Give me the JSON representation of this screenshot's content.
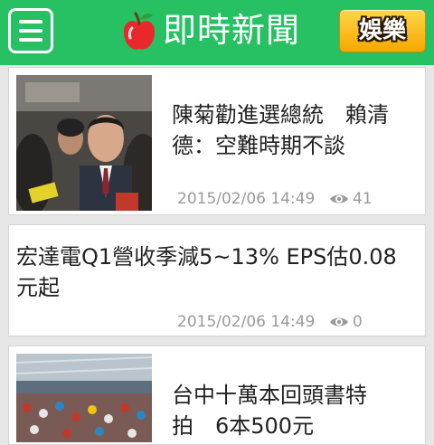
{
  "header": {
    "title": "即時新聞",
    "entertainment_label": "娛樂",
    "menu_icon": "hamburger-menu-icon",
    "logo_icon": "apple-logo-icon",
    "brand_color": "#27c063"
  },
  "articles": [
    {
      "title_line1": "陳菊勸進選總統　賴清",
      "title_line2": "德：空難時期不談",
      "timestamp": "2015/02/06 14:49",
      "views": "41",
      "view_icon": "eye-icon"
    },
    {
      "title_line1": "宏達電Q1營收季減5~13% EPS估0.08",
      "title_line2": "元起",
      "timestamp": "2015/02/06 14:49",
      "views": "0",
      "view_icon": "eye-icon"
    },
    {
      "title_line1": "台中十萬本回頭書特",
      "title_line2": "拍　6本500元",
      "timestamp": "",
      "views": "",
      "view_icon": "eye-icon"
    }
  ]
}
